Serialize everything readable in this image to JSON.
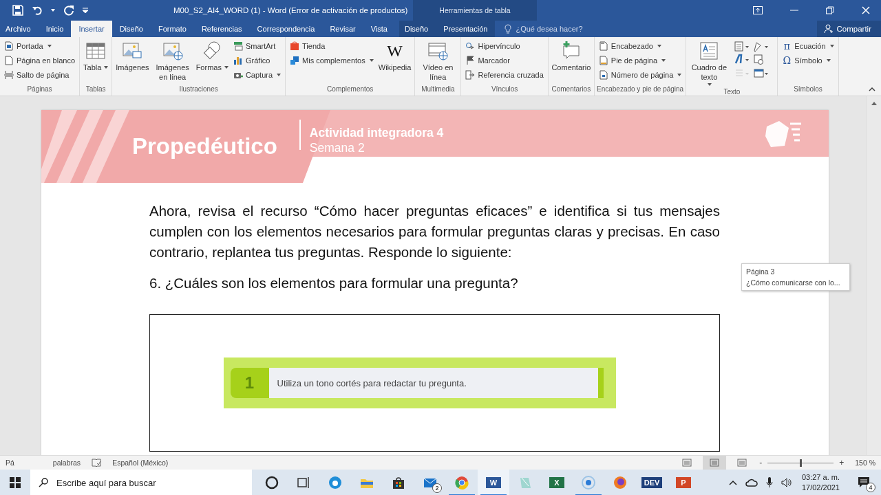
{
  "title_bar": {
    "title": "M00_S2_AI4_WORD (1) - Word (Error de activación de productos)",
    "context_label": "Herramientas de tabla"
  },
  "tabs": [
    {
      "label": "Archivo",
      "selected": false,
      "contextual": false
    },
    {
      "label": "Inicio",
      "selected": false,
      "contextual": false
    },
    {
      "label": "Insertar",
      "selected": true,
      "contextual": false
    },
    {
      "label": "Diseño",
      "selected": false,
      "contextual": false
    },
    {
      "label": "Formato",
      "selected": false,
      "contextual": false
    },
    {
      "label": "Referencias",
      "selected": false,
      "contextual": false
    },
    {
      "label": "Correspondencia",
      "selected": false,
      "contextual": false
    },
    {
      "label": "Revisar",
      "selected": false,
      "contextual": false
    },
    {
      "label": "Vista",
      "selected": false,
      "contextual": false
    },
    {
      "label": "Diseño",
      "selected": false,
      "contextual": true
    },
    {
      "label": "Presentación",
      "selected": false,
      "contextual": true
    }
  ],
  "tell_me": {
    "placeholder": "¿Qué desea hacer?"
  },
  "share_button": "Compartir",
  "ribbon": [
    {
      "label": "Páginas",
      "items": [
        {
          "kind": "stack",
          "rows": [
            {
              "label": "Portada",
              "dropdown": true
            },
            {
              "label": "Página en blanco",
              "dropdown": false
            },
            {
              "label": "Salto de página",
              "dropdown": false
            }
          ]
        }
      ]
    },
    {
      "label": "Tablas",
      "items": [
        {
          "kind": "large",
          "label": "Tabla",
          "dropdown": true
        }
      ]
    },
    {
      "label": "Ilustraciones",
      "items": [
        {
          "kind": "large",
          "label": "Imágenes",
          "dropdown": false
        },
        {
          "kind": "large",
          "label": "Imágenes en línea",
          "dropdown": false
        },
        {
          "kind": "large",
          "label": "Formas",
          "dropdown": true
        },
        {
          "kind": "stack",
          "rows": [
            {
              "label": "SmartArt",
              "dropdown": false
            },
            {
              "label": "Gráfico",
              "dropdown": false
            },
            {
              "label": "Captura",
              "dropdown": true
            }
          ]
        }
      ]
    },
    {
      "label": "Complementos",
      "items": [
        {
          "kind": "stack",
          "rows": [
            {
              "label": "Tienda",
              "dropdown": false
            },
            {
              "label": "Mis complementos",
              "dropdown": true
            }
          ]
        },
        {
          "kind": "large",
          "label": "Wikipedia",
          "dropdown": false,
          "glyph": "W"
        }
      ]
    },
    {
      "label": "Multimedia",
      "items": [
        {
          "kind": "large",
          "label": "Vídeo en línea",
          "dropdown": false
        }
      ]
    },
    {
      "label": "Vínculos",
      "items": [
        {
          "kind": "stack",
          "rows": [
            {
              "label": "Hipervínculo",
              "dropdown": false
            },
            {
              "label": "Marcador",
              "dropdown": false
            },
            {
              "label": "Referencia cruzada",
              "dropdown": false
            }
          ]
        }
      ]
    },
    {
      "label": "Comentarios",
      "items": [
        {
          "kind": "large",
          "label": "Comentario",
          "dropdown": false
        }
      ]
    },
    {
      "label": "Encabezado y pie de página",
      "items": [
        {
          "kind": "stack",
          "rows": [
            {
              "label": "Encabezado",
              "dropdown": true
            },
            {
              "label": "Pie de página",
              "dropdown": true
            },
            {
              "label": "Número de página",
              "dropdown": true
            }
          ]
        }
      ]
    },
    {
      "label": "Texto",
      "items": [
        {
          "kind": "large",
          "label": "Cuadro de texto",
          "dropdown": true
        },
        {
          "kind": "tools"
        }
      ]
    },
    {
      "label": "Símbolos",
      "items": [
        {
          "kind": "stack",
          "rows": [
            {
              "label": "Ecuación",
              "dropdown": true,
              "glyph": "π"
            },
            {
              "label": "Símbolo",
              "dropdown": true,
              "glyph": "Ω"
            }
          ]
        }
      ]
    }
  ],
  "document": {
    "header": {
      "brand": "Propedéutico",
      "title": "Actividad integradora 4",
      "subtitle": "Semana 2"
    },
    "paragraph": "Ahora, revisa el recurso “Cómo hacer preguntas eficaces” e identifica si tus mensajes cumplen con los elementos necesarios para formular preguntas claras y precisas. En caso contrario, replantea tus preguntas. Responde lo siguiente:",
    "question": "6. ¿Cuáles son los elementos para formular una pregunta?",
    "table_image": {
      "number": "1",
      "text": "Utiliza un tono cortés para redactar tu pregunta."
    }
  },
  "tooltip": {
    "title": "Página 3",
    "text": "¿Cómo comunicarse con lo..."
  },
  "status_bar": {
    "page_fragment": "Pá",
    "words": "palabras",
    "language": "Español (México)",
    "views": [
      {
        "selected": false
      },
      {
        "selected": true
      },
      {
        "selected": false
      }
    ],
    "zoom_out": "-",
    "zoom_in": "+",
    "zoom": {
      "level": 0.5
    },
    "zoom_reading": "150 %"
  },
  "taskbar": {
    "search": {
      "placeholder": "Escribe aquí para buscar"
    },
    "apps": [
      {
        "running": false,
        "selected": false
      },
      {
        "running": false,
        "selected": false
      },
      {
        "running": false,
        "selected": false
      },
      {
        "running": false,
        "selected": false
      },
      {
        "running": false,
        "selected": false
      },
      {
        "running": false,
        "selected": false,
        "badge": "2"
      },
      {
        "running": true,
        "selected": false
      },
      {
        "running": true,
        "selected": true,
        "glyph": "W"
      },
      {
        "running": false,
        "selected": false
      },
      {
        "running": false,
        "selected": false,
        "glyph": "X"
      },
      {
        "running": true,
        "selected": false
      },
      {
        "running": false,
        "selected": false
      },
      {
        "running": false,
        "selected": false,
        "glyph": "DEV"
      },
      {
        "running": false,
        "selected": false,
        "glyph": "P"
      }
    ],
    "clock": {
      "time": "03:27 a. m.",
      "date": "17/02/2021"
    },
    "notifications": "4"
  }
}
